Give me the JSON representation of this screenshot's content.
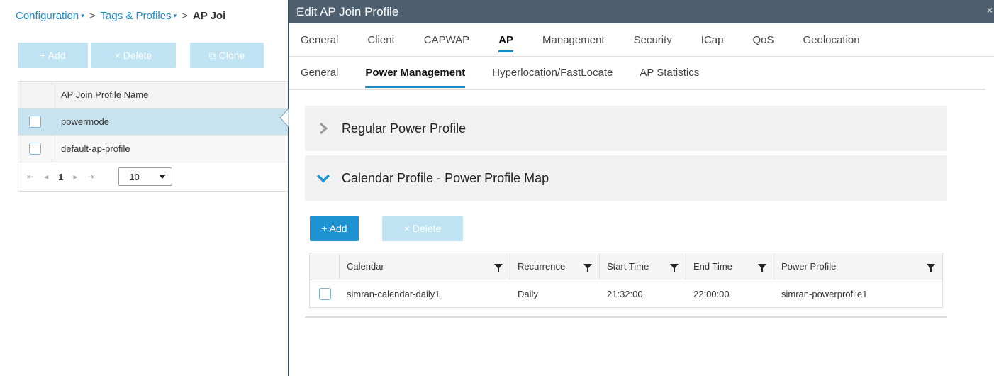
{
  "breadcrumb": {
    "item1": "Configuration",
    "item2": "Tags & Profiles",
    "current": "AP Joi",
    "sep": ">",
    "caret": "▾"
  },
  "left_toolbar": {
    "add_label": "+ Add",
    "delete_label": "× Delete",
    "clone_label": "⧉ Clone"
  },
  "left_table": {
    "header": "AP Join Profile Name",
    "rows": [
      "powermode",
      "default-ap-profile"
    ]
  },
  "pager": {
    "first": "⇤",
    "prev": "◂",
    "page": "1",
    "next": "▸",
    "last": "⇥",
    "page_size": "10"
  },
  "modal": {
    "title": "Edit AP Join Profile",
    "close": "×",
    "tabs": [
      "General",
      "Client",
      "CAPWAP",
      "AP",
      "Management",
      "Security",
      "ICap",
      "QoS",
      "Geolocation"
    ],
    "subtabs": [
      "General",
      "Power Management",
      "Hyperlocation/FastLocate",
      "AP Statistics"
    ],
    "section1": "Regular Power Profile",
    "section2": "Calendar Profile - Power Profile Map",
    "add_label": "+ Add",
    "delete_label": "× Delete",
    "table": {
      "headers": [
        "Calendar",
        "Recurrence",
        "Start Time",
        "End Time",
        "Power Profile"
      ],
      "row": [
        "simran-calendar-daily1",
        "Daily",
        "21:32:00",
        "22:00:00",
        "simran-powerprofile1"
      ]
    }
  },
  "colors": {
    "accent": "#1f93d1",
    "title_bar": "#4e6070",
    "selected_row": "#c7e3ef"
  },
  "icons": [
    "chevron-right-icon",
    "chevron-down-icon",
    "filter-icon",
    "clone-icon",
    "close-icon"
  ]
}
